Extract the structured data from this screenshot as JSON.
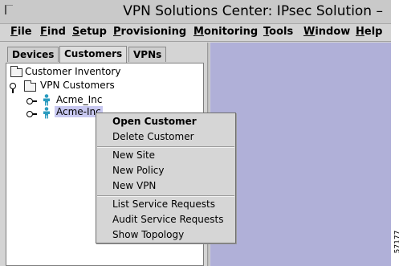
{
  "window": {
    "title": "VPN Solutions Center: IPsec Solution –"
  },
  "menubar": {
    "items": [
      {
        "first": "F",
        "rest": "ile"
      },
      {
        "first": "F",
        "rest": "ind"
      },
      {
        "first": "S",
        "rest": "etup"
      },
      {
        "first": "P",
        "rest": "rovisioning"
      },
      {
        "first": "M",
        "rest": "onitoring"
      },
      {
        "first": "T",
        "rest": "ools"
      },
      {
        "first": "W",
        "rest": "indow"
      },
      {
        "first": "H",
        "rest": "elp"
      }
    ]
  },
  "tabs": [
    {
      "label": "Devices",
      "active": false
    },
    {
      "label": "Customers",
      "active": true
    },
    {
      "label": "VPNs",
      "active": false
    }
  ],
  "tree": {
    "root": "Customer Inventory",
    "group": "VPN Customers",
    "children": [
      "Acme_Inc",
      "Acme-Inc"
    ]
  },
  "context_menu": {
    "open_customer": "Open Customer",
    "delete_customer": "Delete Customer",
    "new_site": "New Site",
    "new_policy": "New Policy",
    "new_vpn": "New VPN",
    "list_service_requests": "List Service Requests",
    "audit_service_requests": "Audit Service Requests",
    "show_topology": "Show Topology"
  },
  "figure_id": "57177",
  "colors": {
    "right_panel": "#b0b0d8",
    "selection": "#c8c8f0",
    "person_icon": "#2a9bbf"
  }
}
